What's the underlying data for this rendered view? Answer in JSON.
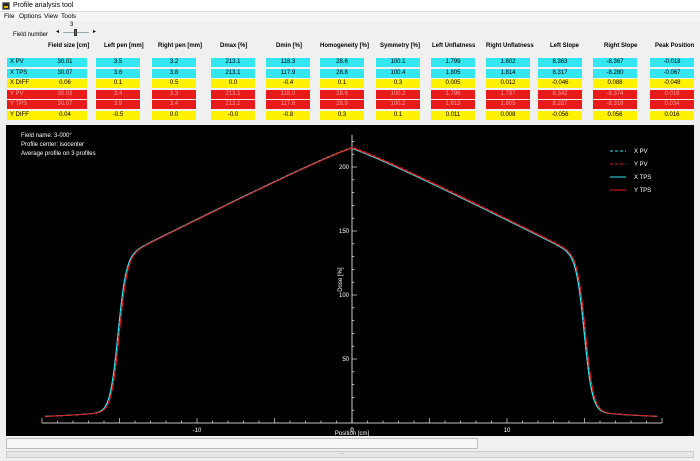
{
  "window": {
    "title": "Profile analysis tool"
  },
  "menu": [
    "File",
    "Options",
    "View",
    "Tools"
  ],
  "field_control": {
    "label": "Field number",
    "value": "3"
  },
  "columns": [
    "Field size [cm]",
    "Left pen [mm]",
    "Right pen [mm]",
    "Dmax [%]",
    "Dmin [%]",
    "Homogeneity [%]",
    "Symmetry [%]",
    "Left Unflatness",
    "Right Unflatness",
    "Left Slope",
    "Right Slope",
    "Peak Position"
  ],
  "rows": [
    {
      "label": "X PV",
      "color": "cyan",
      "values": [
        "30.01",
        "3.5",
        "3.2",
        "213.1",
        "118.3",
        "28.6",
        "100.1",
        "1.799",
        "1.802",
        "8.363",
        "-8.367",
        "-0.018"
      ]
    },
    {
      "label": "X TPS",
      "color": "cyan",
      "values": [
        "30.07",
        "3.6",
        "3.8",
        "213.1",
        "117.9",
        "28.8",
        "100.4",
        "1.805",
        "1.814",
        "8.317",
        "-8.280",
        "-0.067"
      ]
    },
    {
      "label": "X DIFF",
      "color": "yellow",
      "values": [
        "0.06",
        "0.1",
        "0.5",
        "0.0",
        "-0.4",
        "0.1",
        "0.3",
        "0.005",
        "0.012",
        "-0.046",
        "0.088",
        "-0.048"
      ]
    },
    {
      "label": "Y PV",
      "color": "red",
      "values": [
        "30.03",
        "3.4",
        "3.3",
        "213.1",
        "118.0",
        "28.6",
        "100.2",
        "1.796",
        "1.797",
        "8.342",
        "-8.374",
        "0.016"
      ]
    },
    {
      "label": "Y TPS",
      "color": "red",
      "values": [
        "30.07",
        "3.9",
        "3.4",
        "213.1",
        "117.6",
        "28.9",
        "100.2",
        "1.813",
        "1.805",
        "8.287",
        "-8.318",
        "0.034"
      ]
    },
    {
      "label": "Y DIFF",
      "color": "yellow",
      "values": [
        "0.04",
        "-0.5",
        "0.0",
        "-0.0",
        "-0.8",
        "0.3",
        "0.1",
        "0.011",
        "0.008",
        "-0.056",
        "0.056",
        "0.016"
      ]
    }
  ],
  "plot": {
    "info": [
      "Field name: 3-000°",
      "Profile center: isocenter",
      "Average profile on  3 profiles"
    ],
    "background": "#000000",
    "legend": [
      {
        "name": "X PV",
        "color": "#33e6f0",
        "style": "dashed"
      },
      {
        "name": "Y PV",
        "color": "#e81b1b",
        "style": "dashed"
      },
      {
        "name": "X TPS",
        "color": "#33e6f0",
        "style": "solid"
      },
      {
        "name": "Y TPS",
        "color": "#e81b1b",
        "style": "solid"
      }
    ],
    "xlabel": "Position [cm]",
    "ylabel": "Dose [%]",
    "xlim": [
      -20,
      20
    ],
    "ylim": [
      0,
      225
    ],
    "xticks": [
      "-10",
      "0",
      "10"
    ],
    "yticks": [
      "50",
      "100",
      "150",
      "200"
    ]
  }
}
